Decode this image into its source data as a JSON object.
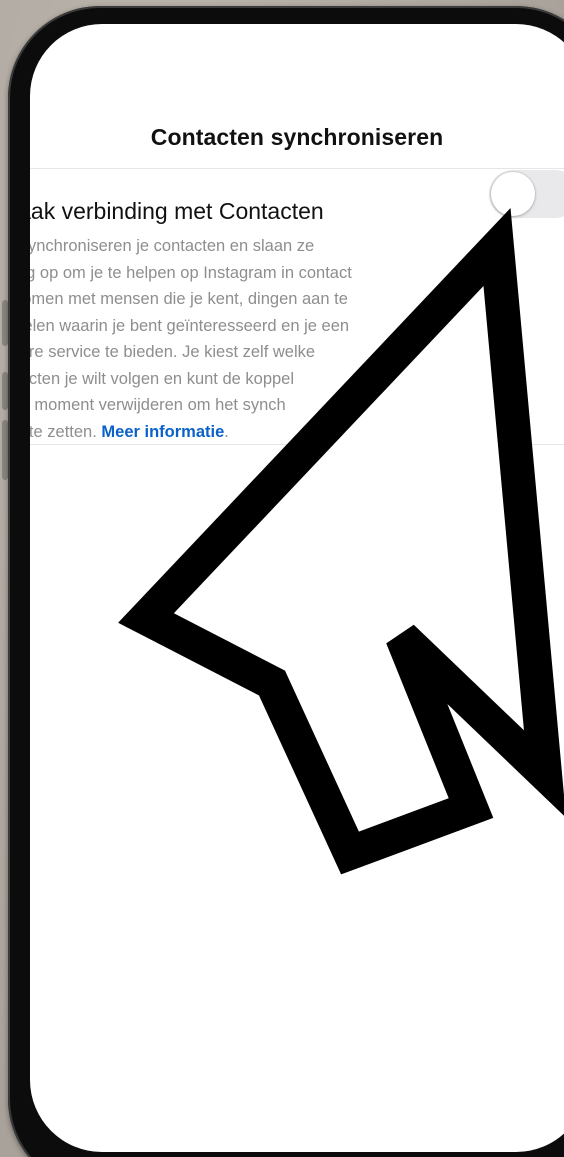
{
  "header": {
    "title": "Contacten synchroniseren"
  },
  "setting": {
    "title": "laak verbinding met Contacten",
    "toggle_state": "off",
    "description_lines": [
      "e synchroniseren je contacten en slaan ze",
      "eilig op om je te helpen op Instagram in contact",
      "komen met mensen die je kent, dingen aan te",
      "evelen waarin je bent geïnteresseerd en je een",
      "etere service te bieden. Je kiest zelf welke",
      "ntacten je wilt volgen en kunt de koppel",
      "der moment verwijderen om het synch",
      "op te zetten. "
    ],
    "link_label": "Meer informatie",
    "link_suffix": "."
  },
  "overlay": {
    "icon": "mouse-pointer-arrow-icon"
  },
  "colors": {
    "link": "#0a62c9",
    "secondary_text": "#8e8e8e",
    "toggle_off": "#e9e9eb",
    "background": "#b2aca4"
  }
}
